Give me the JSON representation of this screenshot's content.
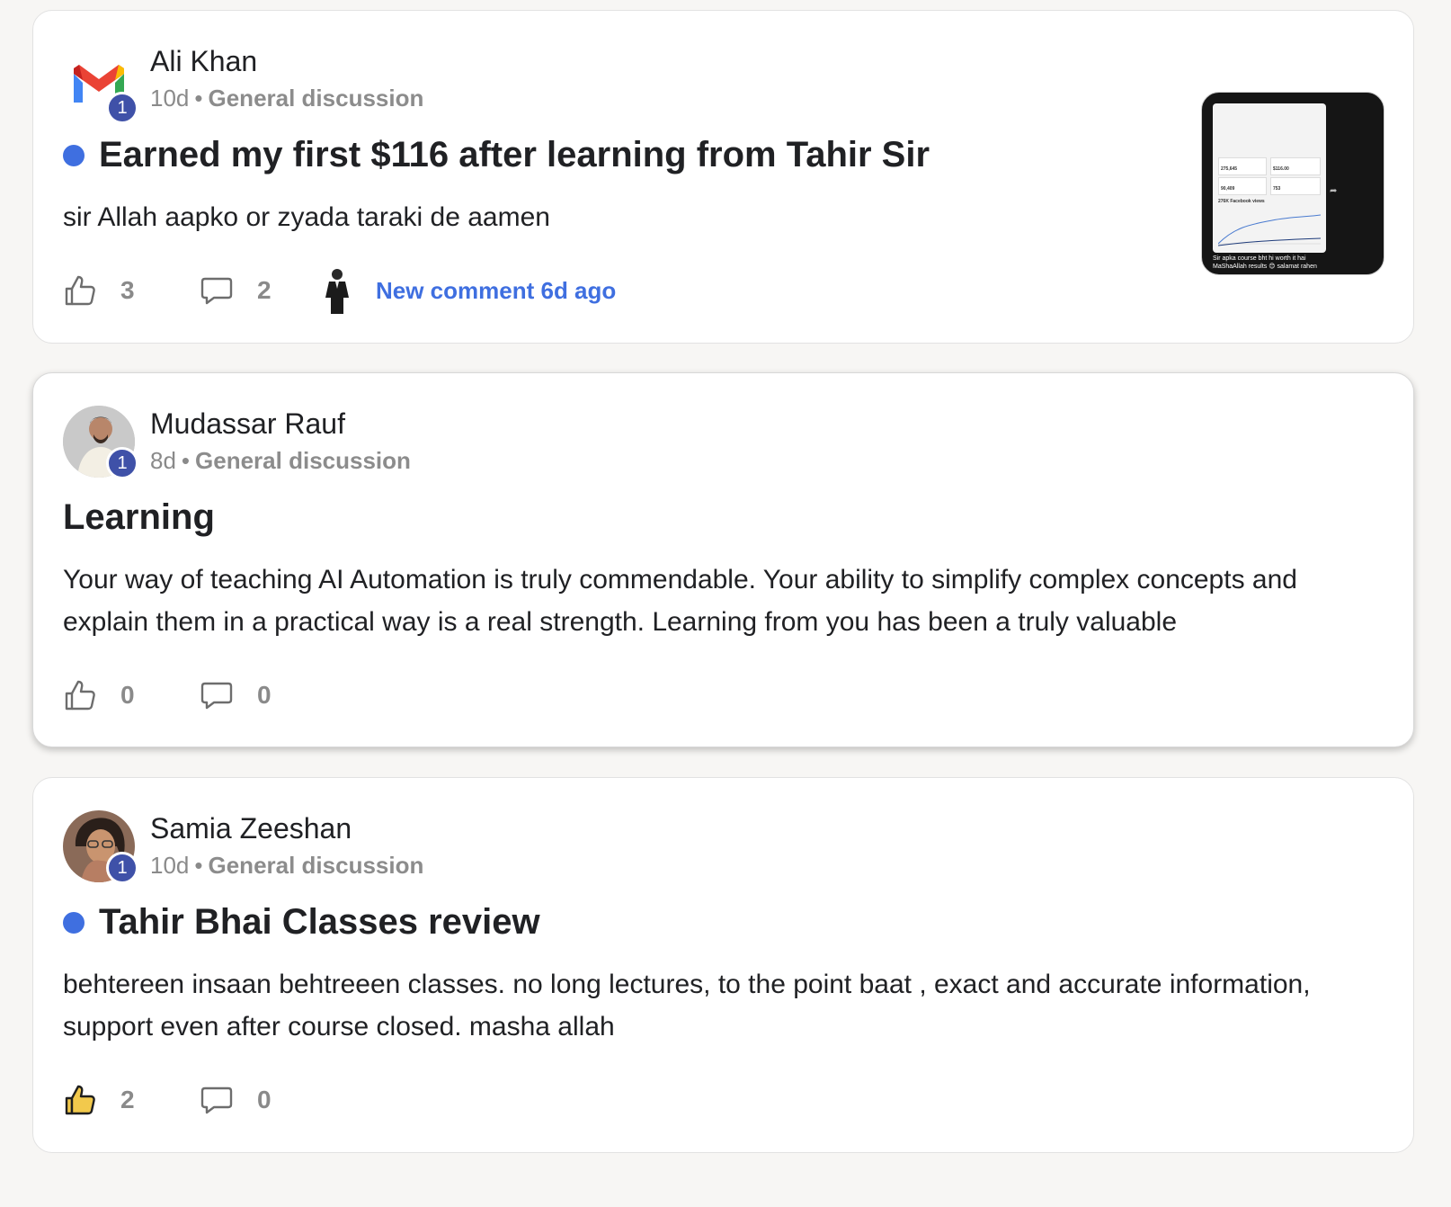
{
  "posts": [
    {
      "author": "Ali Khan",
      "age": "10d",
      "category": "General discussion",
      "level": "1",
      "title": "Earned my first $116 after learning from Tahir Sir",
      "unread": true,
      "body": "sir Allah aapko or zyada taraki de aamen",
      "likes": "3",
      "comments": "2",
      "new_comment": "New comment 6d ago",
      "avatar_icon": "gmail-logo-icon",
      "thumbnail": {
        "stats": [
          "275,645",
          "$116.00",
          "90,409",
          "753"
        ],
        "chart_title": "276K Facebook views",
        "caption": "Sir apka course bht hi worth it hai MaShaAllah results 😊 salamat rahen"
      }
    },
    {
      "author": "Mudassar Rauf",
      "age": "8d",
      "category": "General discussion",
      "level": "1",
      "title": "Learning",
      "unread": false,
      "body": "Your way of teaching AI Automation is truly commendable. Your ability to simplify complex concepts and explain them in a practical way is a real strength. Learning from you has been a truly valuable",
      "likes": "0",
      "comments": "0"
    },
    {
      "author": "Samia Zeeshan",
      "age": "10d",
      "category": "General discussion",
      "level": "1",
      "title": "Tahir Bhai Classes review",
      "unread": true,
      "body": "behtereen insaan behtreeen classes. no long lectures, to the point baat , exact and accurate information, support even after course closed. masha allah",
      "likes": "2",
      "comments": "0",
      "liked": true
    }
  ],
  "colors": {
    "accent": "#3f6fe0",
    "badge": "#3f51a8",
    "liked": "#f2c94c"
  }
}
